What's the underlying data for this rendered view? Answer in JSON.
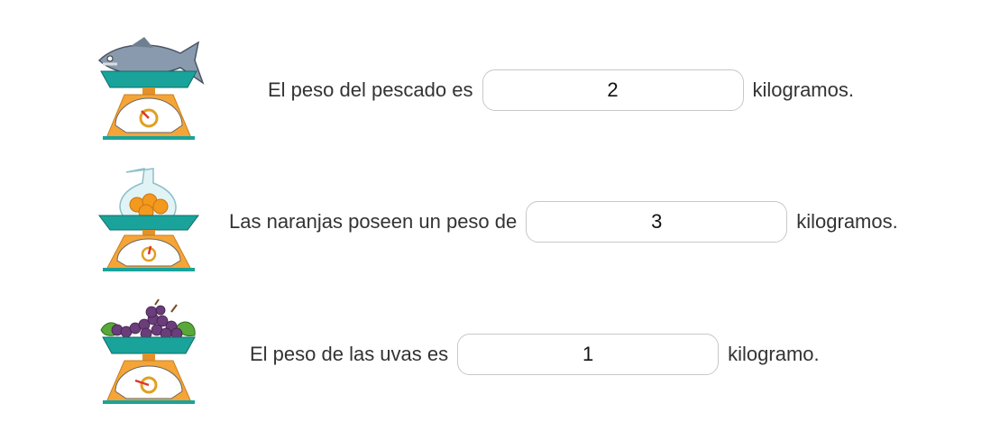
{
  "items": [
    {
      "prefix": "El peso del pescado es",
      "value": "2",
      "suffix": "kilogramos.",
      "icon": "fish-on-scale"
    },
    {
      "prefix": "Las naranjas poseen un peso de",
      "value": "3",
      "suffix": "kilogramos.",
      "icon": "oranges-on-scale"
    },
    {
      "prefix": "El peso de las uvas es",
      "value": "1",
      "suffix": "kilogramo.",
      "icon": "grapes-on-scale"
    }
  ],
  "colors": {
    "scale_body": "#f5a537",
    "scale_tray": "#1aa39a",
    "dial_needle": "#e0352b",
    "input_border": "#c8c8c8",
    "text": "#333333"
  }
}
